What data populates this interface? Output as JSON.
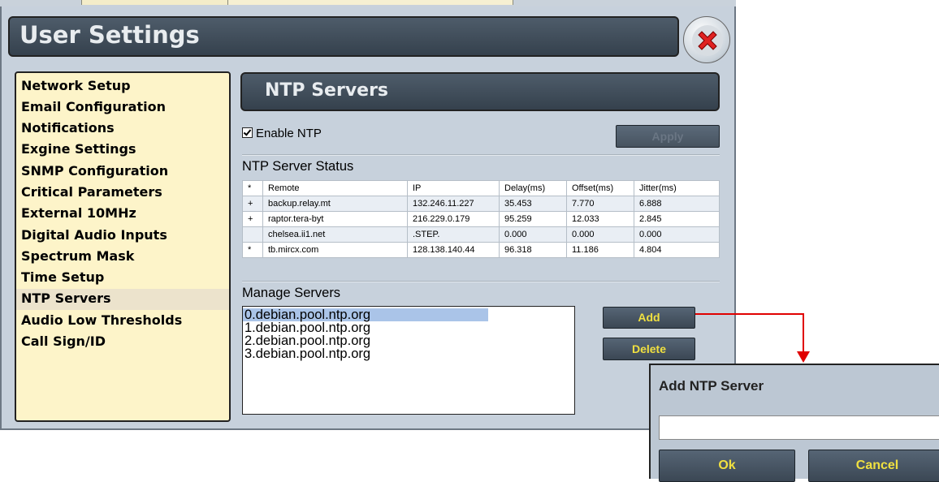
{
  "window": {
    "title": "User Settings"
  },
  "sidebar": {
    "items": [
      {
        "label": "Network Setup"
      },
      {
        "label": "Email Configuration"
      },
      {
        "label": "Notifications"
      },
      {
        "label": "Exgine Settings"
      },
      {
        "label": "SNMP Configuration"
      },
      {
        "label": "Critical Parameters"
      },
      {
        "label": "External 10MHz"
      },
      {
        "label": "Digital Audio Inputs"
      },
      {
        "label": "Spectrum Mask"
      },
      {
        "label": "Time Setup"
      },
      {
        "label": "NTP Servers",
        "selected": true
      },
      {
        "label": "Audio Low Thresholds"
      },
      {
        "label": "Call Sign/ID"
      }
    ]
  },
  "panel": {
    "title": "NTP Servers",
    "enable_label": "Enable NTP",
    "enable_checked": true,
    "apply_label": "Apply",
    "status_title": "NTP Server Status",
    "table": {
      "headers": [
        "*",
        "Remote",
        "IP",
        "Delay(ms)",
        "Offset(ms)",
        "Jitter(ms)"
      ],
      "rows": [
        [
          "+",
          "backup.relay.mt",
          "132.246.11.227",
          "35.453",
          "7.770",
          "6.888"
        ],
        [
          "+",
          "raptor.tera-byt",
          "216.229.0.179",
          "95.259",
          "12.033",
          "2.845"
        ],
        [
          "",
          "chelsea.ii1.net",
          ".STEP.",
          "0.000",
          "0.000",
          "0.000"
        ],
        [
          "*",
          "tb.mircx.com",
          "128.138.140.44",
          "96.318",
          "11.186",
          "4.804"
        ]
      ]
    },
    "manage_title": "Manage Servers",
    "servers": [
      "0.debian.pool.ntp.org",
      "1.debian.pool.ntp.org",
      "2.debian.pool.ntp.org",
      "3.debian.pool.ntp.org"
    ],
    "add_label": "Add",
    "delete_label": "Delete"
  },
  "dialog": {
    "title": "Add NTP Server",
    "input_value": "",
    "ok_label": "Ok",
    "cancel_label": "Cancel"
  },
  "colors": {
    "title_bar": "#3f4b57",
    "sidebar_bg": "#fdf4c9",
    "button_text": "#f0e040",
    "arrow": "#e00000"
  }
}
